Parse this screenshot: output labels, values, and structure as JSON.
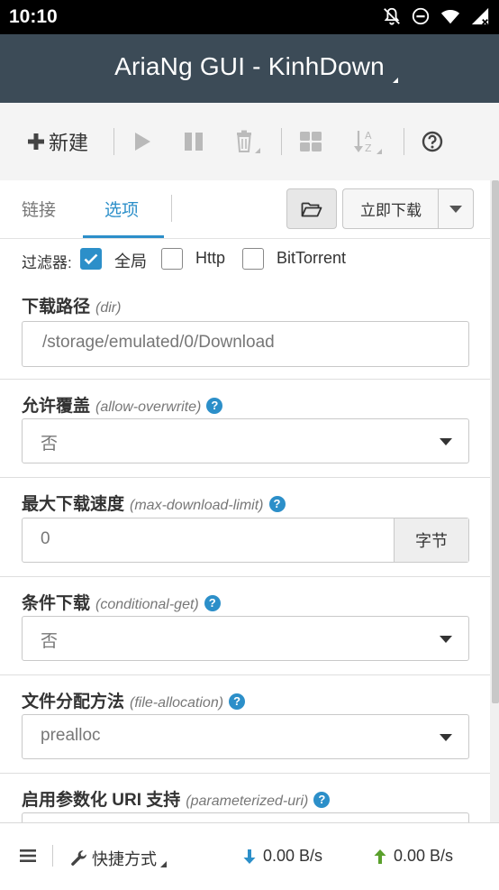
{
  "status_bar": {
    "time": "10:10"
  },
  "header": {
    "title": "AriaNg GUI - KinhDown"
  },
  "toolbar": {
    "new_label": "新建"
  },
  "tabs": [
    {
      "label": "链接"
    },
    {
      "label": "选项"
    }
  ],
  "actions": {
    "download_now_label": "立即下载"
  },
  "filter": {
    "label": "过滤器:",
    "options": [
      {
        "label": "全局",
        "checked": true
      },
      {
        "label": "Http",
        "checked": false
      },
      {
        "label": "BitTorrent",
        "checked": false
      }
    ]
  },
  "options": [
    {
      "title": "下载路径",
      "key": "(dir)",
      "value": "/storage/emulated/0/Download"
    },
    {
      "title": "允许覆盖",
      "key": "(allow-overwrite)",
      "value": "否"
    },
    {
      "title": "最大下载速度",
      "key": "(max-download-limit)",
      "value": "0",
      "unit": "字节"
    },
    {
      "title": "条件下载",
      "key": "(conditional-get)",
      "value": "否"
    },
    {
      "title": "文件分配方法",
      "key": "(file-allocation)",
      "value": "prealloc"
    },
    {
      "title": "启用参数化 URI 支持",
      "key": "(parameterized-uri)",
      "value": ""
    }
  ],
  "footer": {
    "shortcuts_label": "快捷方式",
    "download_speed": "0.00 B/s",
    "upload_speed": "0.00 B/s"
  },
  "colors": {
    "accent": "#2c8fc9",
    "header_bg": "#3c4b57",
    "upload_arrow": "#5aa02c"
  }
}
